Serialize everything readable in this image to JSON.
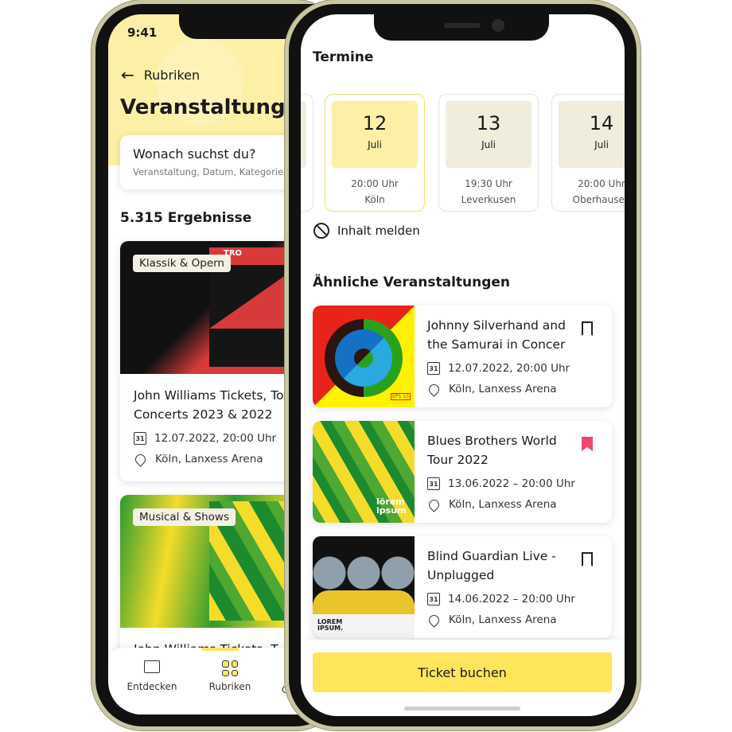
{
  "back_phone": {
    "status_time": "9:41",
    "back_label": "Rubriken",
    "title": "Veranstaltungen",
    "search": {
      "title": "Wonach suchst du?",
      "subtitle": "Veranstaltung, Datum, Kategorie"
    },
    "results_count": "5.315 Ergebnisse",
    "events": [
      {
        "category": "Klassik & Opern",
        "title_line1": "John Williams Tickets, To",
        "title_line2": "Concerts 2023 & 2022",
        "date": "12.07.2022, 20:00 Uhr",
        "location": "Köln, Lanxess Arena",
        "poster_text": "TRO"
      },
      {
        "category": "Musical & Shows",
        "title_line1": "John Williams Tickets, T"
      }
    ],
    "nav": [
      {
        "label": "Entdecken",
        "icon": "chat-icon"
      },
      {
        "label": "Rubriken",
        "icon": "grid-icon",
        "active": true
      },
      {
        "label": "C"
      }
    ]
  },
  "front_phone": {
    "termine_title": "Termine",
    "dates": [
      {
        "day": "12",
        "month": "Juli",
        "time": "20:00 Uhr",
        "city": "Köln",
        "selected": true
      },
      {
        "day": "13",
        "month": "Juli",
        "time": "19:30 Uhr",
        "city": "Leverkusen"
      },
      {
        "day": "14",
        "month": "Juli",
        "time": "20:00 Uhr",
        "city": "Oberhausen"
      }
    ],
    "report_label": "Inhalt melden",
    "similar_title": "Ähnliche Veranstaltungen",
    "similar": [
      {
        "title_line1": "Johnny Silverhand and",
        "title_line2": "the Samurai in Concer",
        "date": "12.07.2022, 20:00 Uhr",
        "location": "Köln, Lanxess Arena",
        "bookmarked": false,
        "poster_text": "EPS 10"
      },
      {
        "title_line1": "Blues Brothers World",
        "title_line2": "Tour 2022",
        "date": "13.06.2022 – 20:00 Uhr",
        "location": "Köln, Lanxess Arena",
        "bookmarked": true,
        "poster_text": "lörem ipsum"
      },
      {
        "title_line1": "Blind Guardian Live -",
        "title_line2": "Unplugged",
        "date": "14.06.2022 – 20:00 Uhr",
        "location": "Köln, Lanxess Arena",
        "bookmarked": false,
        "poster_text": "LOREM IPSUM."
      }
    ],
    "cta_label": "Ticket buchen"
  },
  "colors": {
    "accent": "#ffe55a",
    "bookmark_active": "#f0476a",
    "frame": "#c9c6a2"
  }
}
